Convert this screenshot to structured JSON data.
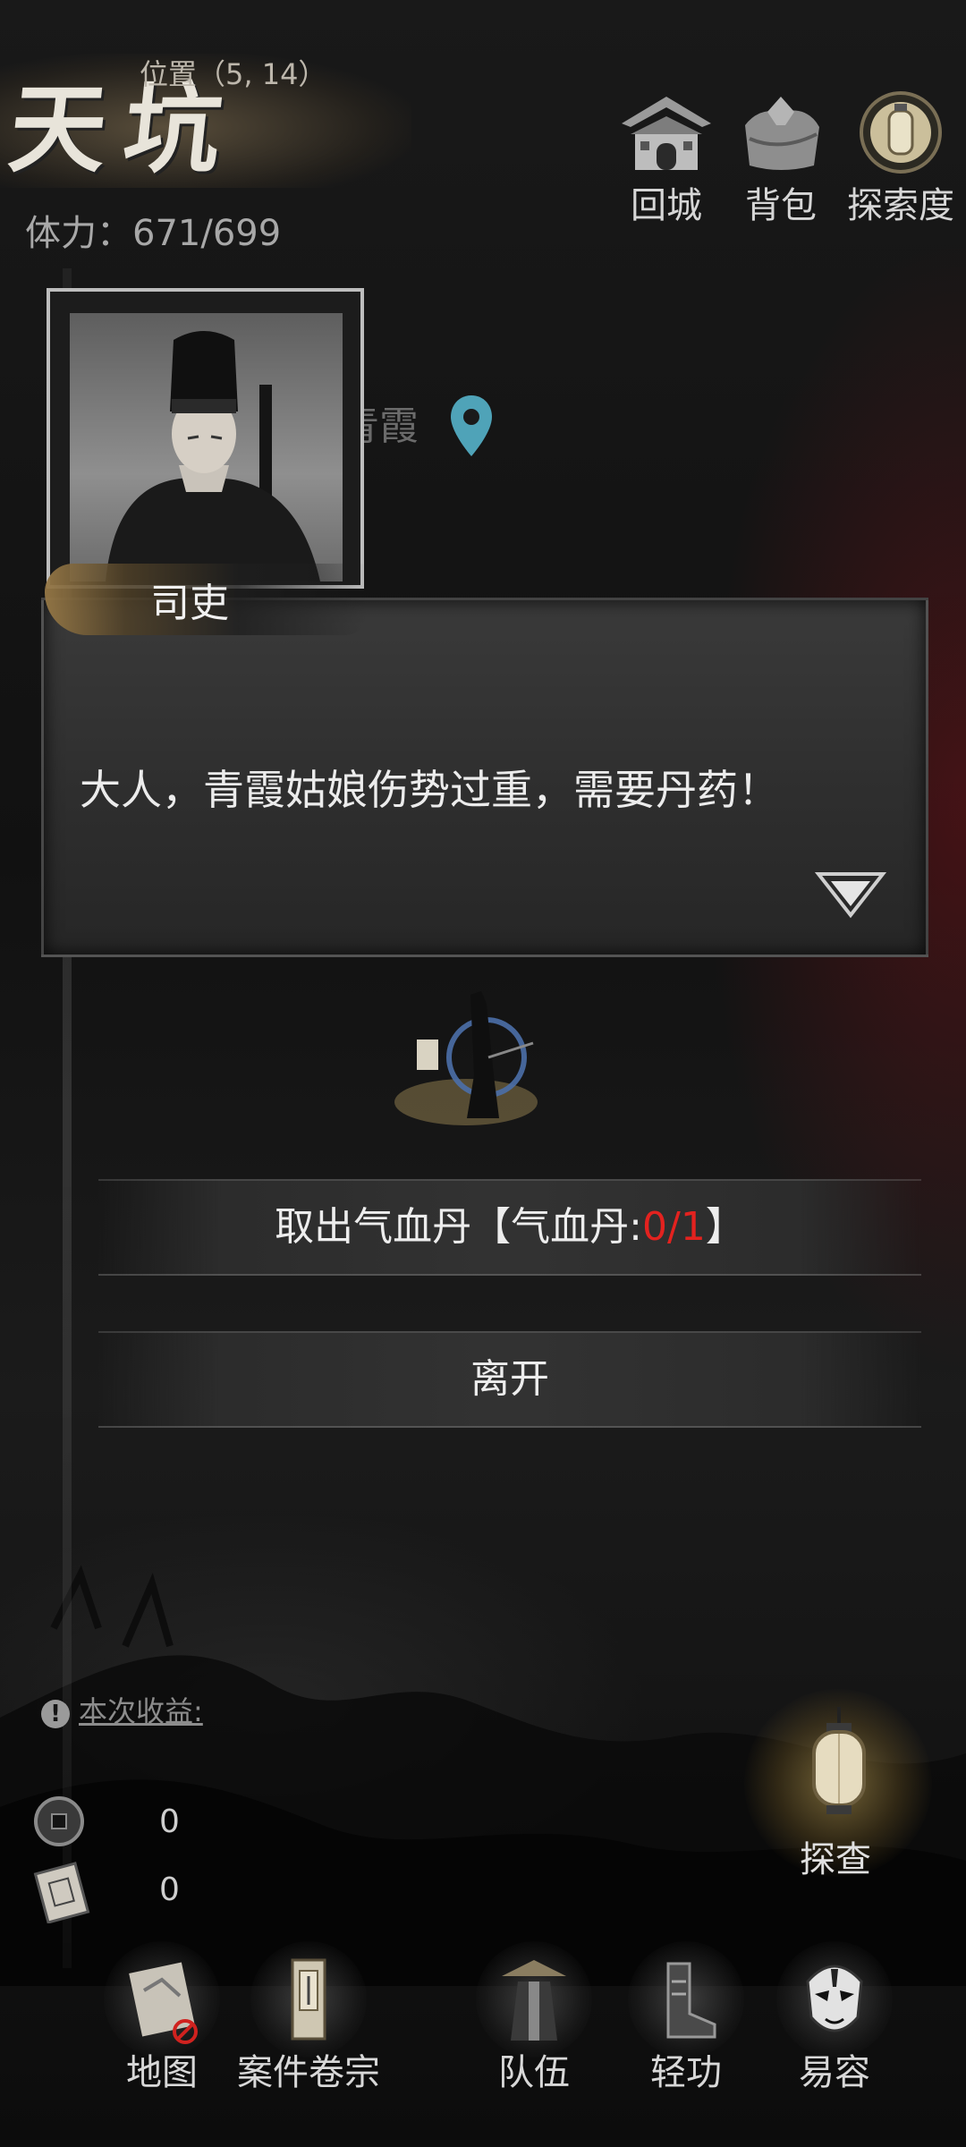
{
  "header": {
    "map_name": "天坑",
    "position_text": "位置（5, 14）",
    "stamina_text": "体力：671/699"
  },
  "top_buttons": [
    {
      "label": "回城",
      "icon": "city-gate-icon"
    },
    {
      "label": "背包",
      "icon": "bundle-icon"
    },
    {
      "label": "探索度",
      "icon": "lantern-icon"
    }
  ],
  "map": {
    "marker_text": "青霞"
  },
  "dialog": {
    "npc_name": "司吏",
    "text": "大人，青霞姑娘伤势过重，需要丹药！"
  },
  "options": {
    "take": {
      "prefix": "取出气血丹【气血丹:",
      "count": "0/1",
      "suffix": "】"
    },
    "leave": "离开"
  },
  "earnings": {
    "title": "本次收益:",
    "coin_value": "0",
    "token_value": "0"
  },
  "investigate_label": "探查",
  "bottom_nav": [
    {
      "label": "地图",
      "icon": "map-scroll-icon"
    },
    {
      "label": "案件卷宗",
      "icon": "case-file-icon"
    },
    {
      "label": "队伍",
      "icon": "team-icon"
    },
    {
      "label": "轻功",
      "icon": "boots-icon"
    },
    {
      "label": "易容",
      "icon": "mask-icon"
    }
  ],
  "colors": {
    "warning_red": "#e3221f",
    "pin_teal": "#4fa3b8"
  }
}
